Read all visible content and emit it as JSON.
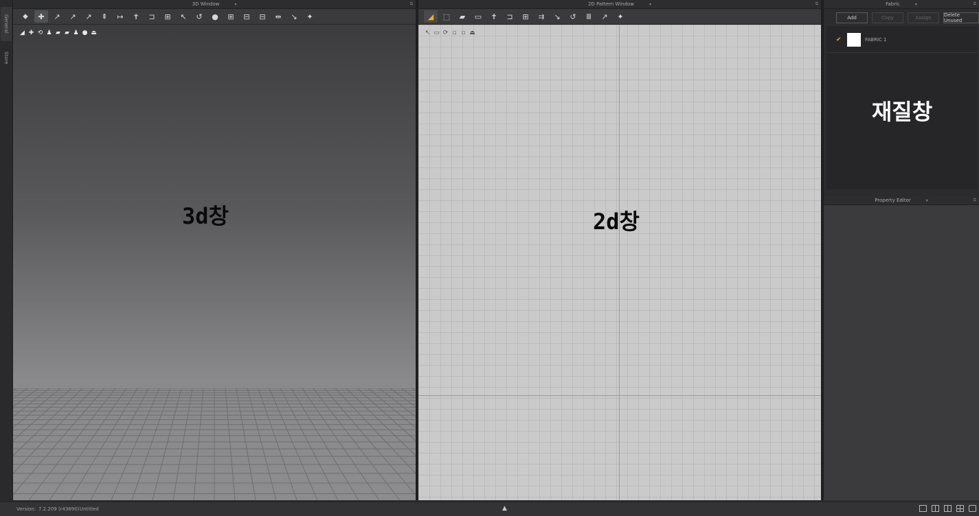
{
  "side_tabs": [
    "General",
    "Store"
  ],
  "window3d": {
    "title": "3D Window",
    "dropdown": "▾",
    "label": "3d창",
    "toolbar": [
      "⬥",
      "✚",
      "↗",
      "↗",
      "↗",
      "⇞",
      "↦",
      "✝",
      "⊐",
      "⊞",
      "↖",
      "↺",
      "●",
      "⊞",
      "⊟",
      "⊟",
      "⇹",
      "↘",
      "✦"
    ],
    "subtools": [
      "◢",
      "✚",
      "⟲",
      "♟",
      "▰",
      "▰",
      "♟",
      "●",
      "⏏"
    ]
  },
  "window2d": {
    "title": "2D Pattern Window",
    "dropdown": "▾",
    "label": "2d창",
    "toolbar": [
      "◢",
      "⬚",
      "▰",
      "▭",
      "✝",
      "⊐",
      "⊞",
      "⇉",
      "↘",
      "↺",
      "Ⅲ",
      "↗",
      "✦"
    ],
    "subtools": [
      "↖",
      "▭",
      "⟳",
      "▫",
      "▫",
      "⏏"
    ]
  },
  "fabric": {
    "title": "Fabric",
    "buttons": {
      "add": "Add",
      "copy": "Copy",
      "assign": "Assign",
      "delete_unused": "Delete Unused"
    },
    "items": [
      {
        "name": "FABRIC 1",
        "color": "#ffffff",
        "checked": true
      }
    ],
    "label": "재질창"
  },
  "property_editor": {
    "title": "Property Editor"
  },
  "status": {
    "version_label": "Version:",
    "version": "7.2.209 (r43690)",
    "file": "Untitled"
  },
  "colors": {
    "accent": "#e8b21a",
    "panel": "#2c2c2e",
    "view2d": "#cacaca"
  }
}
